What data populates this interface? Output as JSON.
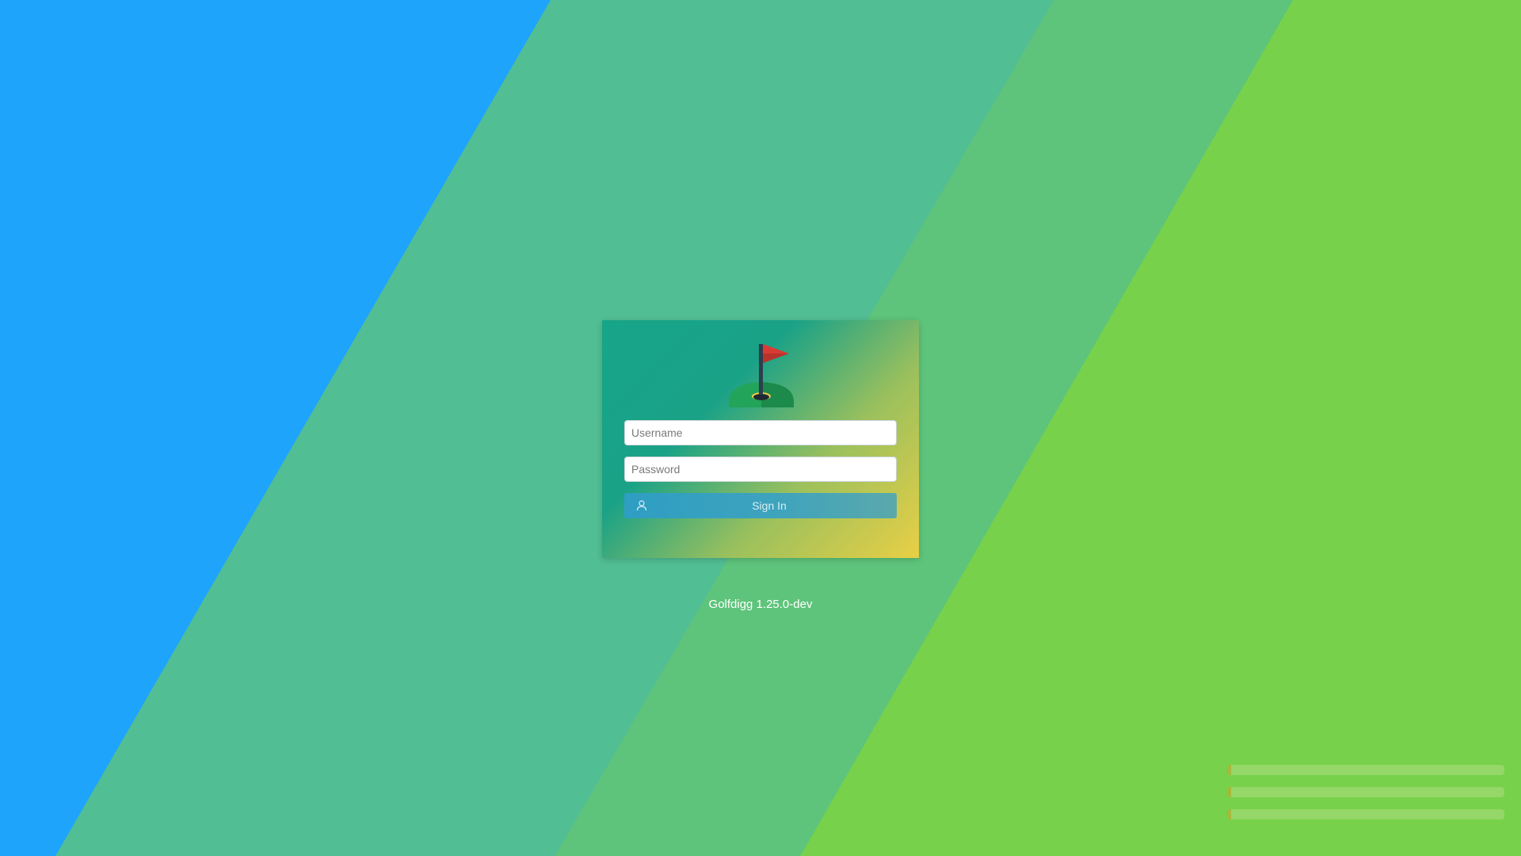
{
  "login": {
    "username_placeholder": "Username",
    "password_placeholder": "Password",
    "signin_label": "Sign In"
  },
  "footer": {
    "version_text": "Golfdigg 1.25.0-dev"
  },
  "icons": {
    "logo": "golf-flag-icon",
    "signin": "user-icon"
  },
  "colors": {
    "background_blue": "#1ea4fb",
    "background_teal": "#52be93",
    "background_green": "#5ec47b",
    "background_lime": "#77d14a",
    "flag_red": "#d83b33",
    "button_blue": "#2e9ec3"
  },
  "notifications": [
    {
      "text": ""
    },
    {
      "text": ""
    },
    {
      "text": ""
    }
  ]
}
